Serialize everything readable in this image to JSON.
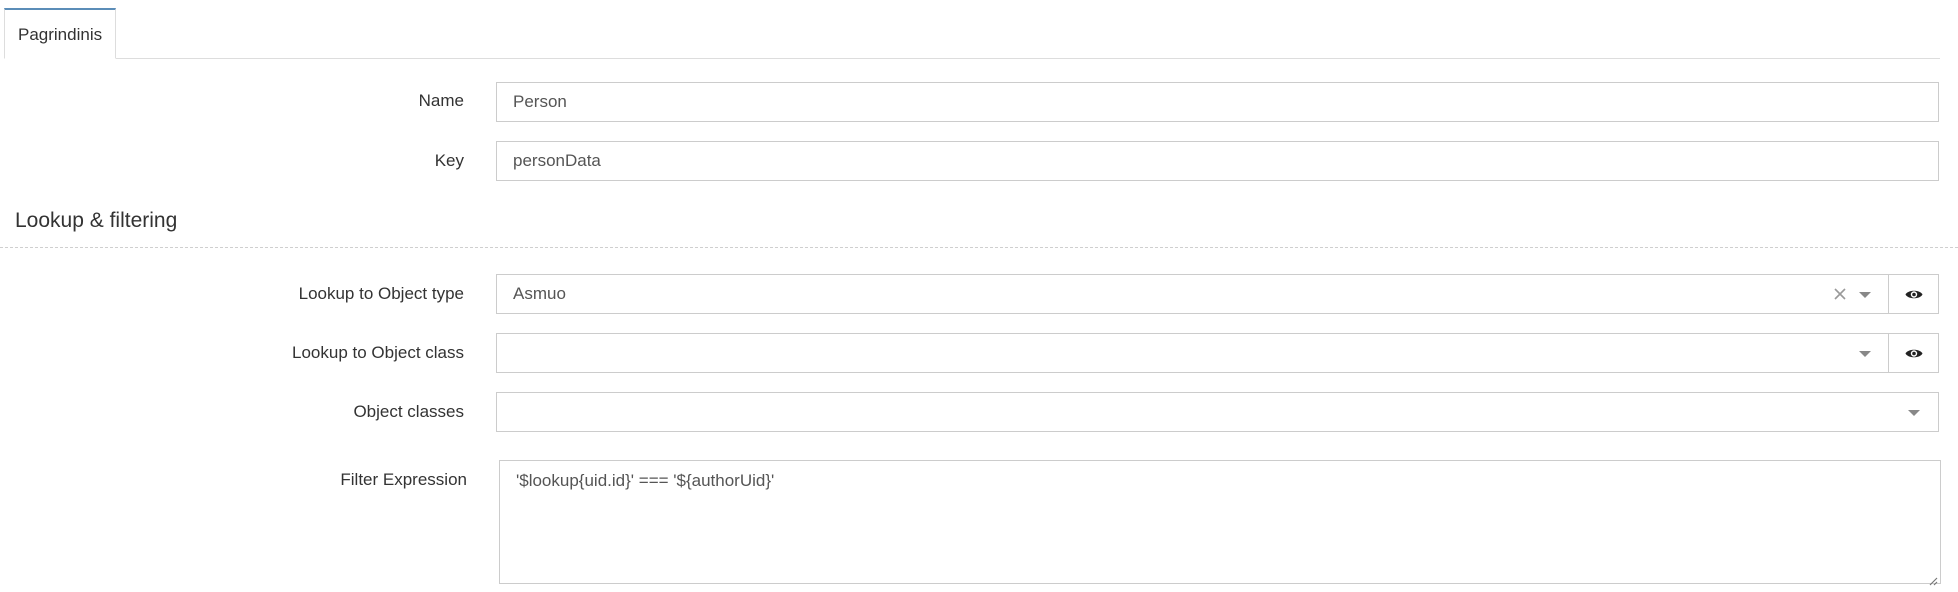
{
  "tabs": [
    {
      "label": "Pagrindinis",
      "active": true
    }
  ],
  "fields": {
    "name": {
      "label": "Name",
      "value": "Person"
    },
    "key": {
      "label": "Key",
      "value": "personData"
    }
  },
  "section": {
    "title": "Lookup & filtering"
  },
  "lookup": {
    "object_type": {
      "label": "Lookup to Object type",
      "value": "Asmuo"
    },
    "object_class": {
      "label": "Lookup to Object class",
      "value": ""
    },
    "object_classes": {
      "label": "Object classes",
      "value": ""
    },
    "filter_expression": {
      "label": "Filter Expression",
      "value": "'$lookup{uid.id}' === '${authorUid}'"
    }
  },
  "icons": {
    "clear": "close-icon",
    "dropdown": "chevron-down-icon",
    "view": "eye-icon"
  },
  "colors": {
    "tab_accent": "#5b8db8",
    "border": "#cccccc",
    "text": "#333333"
  }
}
